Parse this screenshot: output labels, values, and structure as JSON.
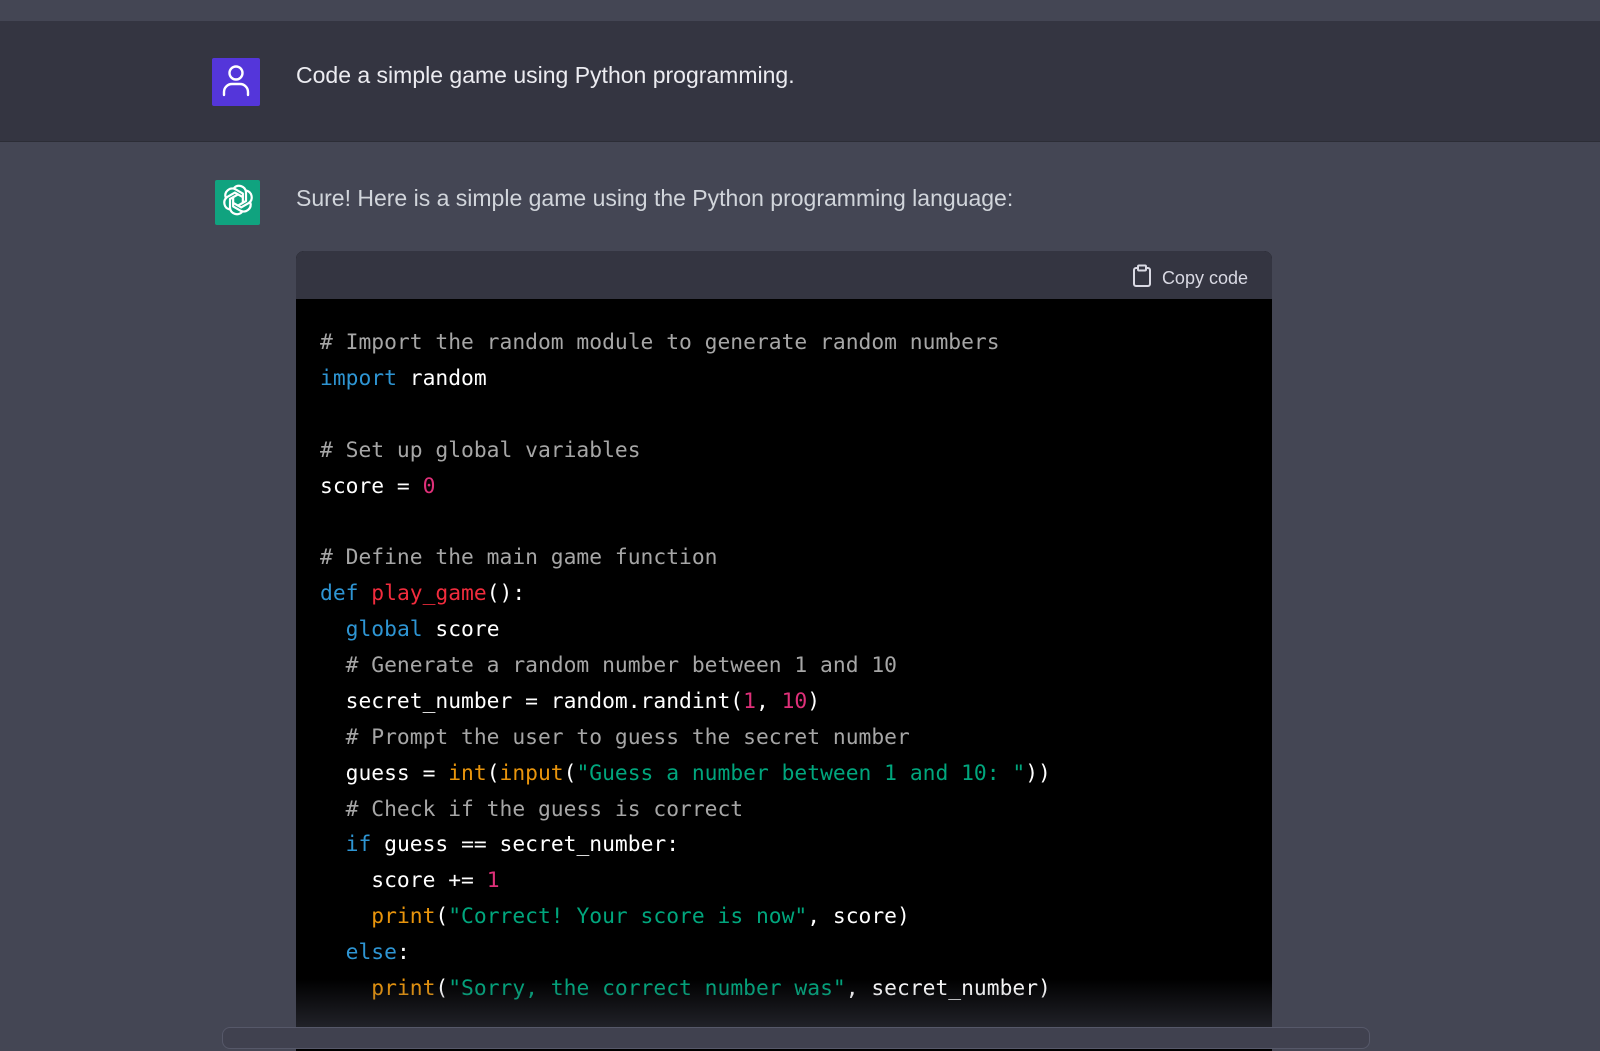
{
  "user_message": {
    "avatar_icon": "user-icon",
    "text": "Code a simple game using Python programming."
  },
  "assistant_message": {
    "avatar_icon": "openai-logo-icon",
    "text": "Sure! Here is a simple game using the Python programming language:",
    "code_block": {
      "copy_label": "Copy code",
      "copy_icon": "clipboard-icon",
      "lines": [
        [
          {
            "t": "# Import the random module to generate random numbers",
            "c": "comment"
          }
        ],
        [
          {
            "t": "import",
            "c": "keyword"
          },
          {
            "t": " random",
            "c": "plain"
          }
        ],
        [],
        [
          {
            "t": "# Set up global variables",
            "c": "comment"
          }
        ],
        [
          {
            "t": "score = ",
            "c": "plain"
          },
          {
            "t": "0",
            "c": "number"
          }
        ],
        [],
        [
          {
            "t": "# Define the main game function",
            "c": "comment"
          }
        ],
        [
          {
            "t": "def",
            "c": "keyword"
          },
          {
            "t": " ",
            "c": "plain"
          },
          {
            "t": "play_game",
            "c": "func"
          },
          {
            "t": "():",
            "c": "plain"
          }
        ],
        [
          {
            "t": "  ",
            "c": "plain"
          },
          {
            "t": "global",
            "c": "keyword"
          },
          {
            "t": " score",
            "c": "plain"
          }
        ],
        [
          {
            "t": "  # Generate a random number between 1 and 10",
            "c": "comment"
          }
        ],
        [
          {
            "t": "  secret_number = random.randint(",
            "c": "plain"
          },
          {
            "t": "1",
            "c": "number"
          },
          {
            "t": ", ",
            "c": "plain"
          },
          {
            "t": "10",
            "c": "number"
          },
          {
            "t": ")",
            "c": "plain"
          }
        ],
        [
          {
            "t": "  # Prompt the user to guess the secret number",
            "c": "comment"
          }
        ],
        [
          {
            "t": "  guess = ",
            "c": "plain"
          },
          {
            "t": "int",
            "c": "builtin"
          },
          {
            "t": "(",
            "c": "plain"
          },
          {
            "t": "input",
            "c": "builtin"
          },
          {
            "t": "(",
            "c": "plain"
          },
          {
            "t": "\"Guess a number between 1 and 10: \"",
            "c": "string"
          },
          {
            "t": "))",
            "c": "plain"
          }
        ],
        [
          {
            "t": "  # Check if the guess is correct",
            "c": "comment"
          }
        ],
        [
          {
            "t": "  ",
            "c": "plain"
          },
          {
            "t": "if",
            "c": "keyword"
          },
          {
            "t": " guess == secret_number:",
            "c": "plain"
          }
        ],
        [
          {
            "t": "    score += ",
            "c": "plain"
          },
          {
            "t": "1",
            "c": "number"
          }
        ],
        [
          {
            "t": "    ",
            "c": "plain"
          },
          {
            "t": "print",
            "c": "builtin"
          },
          {
            "t": "(",
            "c": "plain"
          },
          {
            "t": "\"Correct! Your score is now\"",
            "c": "string"
          },
          {
            "t": ", score)",
            "c": "plain"
          }
        ],
        [
          {
            "t": "  ",
            "c": "plain"
          },
          {
            "t": "else",
            "c": "keyword"
          },
          {
            "t": ":",
            "c": "plain"
          }
        ],
        [
          {
            "t": "    ",
            "c": "plain"
          },
          {
            "t": "print",
            "c": "builtin"
          },
          {
            "t": "(",
            "c": "plain"
          },
          {
            "t": "\"Sorry, the correct number was\"",
            "c": "string"
          },
          {
            "t": ", secret_number)",
            "c": "plain"
          }
        ]
      ]
    }
  },
  "colors": {
    "user_row_bg": "#343541",
    "assistant_row_bg": "#444654",
    "user_avatar": "#5436da",
    "assistant_avatar": "#10a37f",
    "code_bg": "#000000",
    "code_header_bg": "#343541",
    "comment": "#a6a6a6",
    "keyword": "#2e95d3",
    "number": "#df3079",
    "function_name": "#f22c3d",
    "builtin": "#e9950c",
    "string": "#00a67d"
  }
}
